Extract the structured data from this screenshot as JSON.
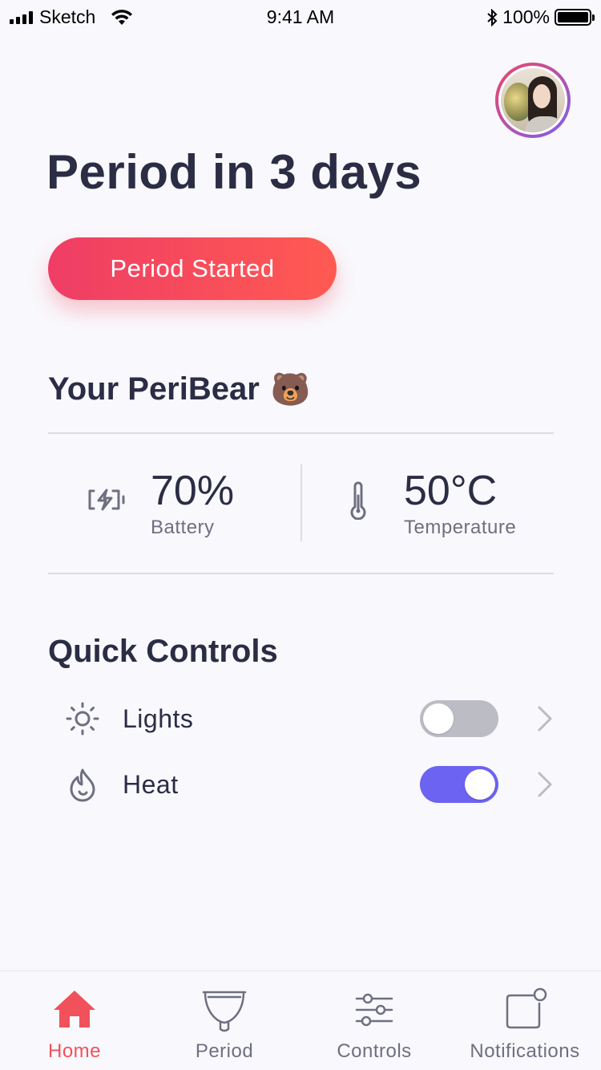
{
  "status_bar": {
    "carrier": "Sketch",
    "time": "9:41 AM",
    "battery_percent": "100%"
  },
  "header": {
    "headline": "Period in 3 days",
    "period_button_label": "Period Started"
  },
  "device": {
    "title": "Your PeriBear",
    "emoji": "🐻",
    "battery_value": "70%",
    "battery_label": "Battery",
    "temperature_value": "50°C",
    "temperature_label": "Temperature"
  },
  "quick_controls": {
    "title": "Quick Controls",
    "items": [
      {
        "label": "Lights",
        "icon": "sun-icon",
        "enabled": false
      },
      {
        "label": "Heat",
        "icon": "flame-icon",
        "enabled": true
      }
    ]
  },
  "tab_bar": {
    "active": "Home",
    "tabs": [
      {
        "label": "Home",
        "icon": "home-icon"
      },
      {
        "label": "Period",
        "icon": "cup-icon"
      },
      {
        "label": "Controls",
        "icon": "sliders-icon"
      },
      {
        "label": "Notifications",
        "icon": "notification-icon"
      }
    ]
  },
  "colors": {
    "accent_red": "#f0515a",
    "toggle_on": "#6c63f2",
    "toggle_off": "#bcbcc4",
    "text_dark": "#2b2d45",
    "text_muted": "#6e7081"
  }
}
